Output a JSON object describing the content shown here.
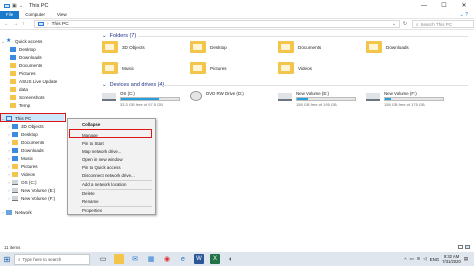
{
  "window": {
    "title": "This PC",
    "min": "—",
    "max": "☐",
    "close": "✕"
  },
  "ribbon": {
    "tabs": [
      "File",
      "Computer",
      "View"
    ],
    "expand": "⌄",
    "help": "?"
  },
  "address": {
    "back": "←",
    "forward": "→",
    "up": "↑",
    "path": "This PC",
    "dropdown": "⌄",
    "refresh": "↻",
    "search_placeholder": "Search This PC"
  },
  "nav": {
    "quick_access": "Quick access",
    "qa_items": [
      "Desktop",
      "Downloads",
      "Documents",
      "Pictures",
      "ASUS Live Update",
      "data",
      "Screenshots",
      "Temp"
    ],
    "this_pc": "This PC",
    "pc_items": [
      "3D Objects",
      "Desktop",
      "Documents",
      "Downloads",
      "Music",
      "Pictures",
      "Videos",
      "OS (C:)",
      "New Volume (E:)",
      "New Volume (F:)"
    ],
    "network": "Network"
  },
  "content": {
    "folders_header": "Folders (7)",
    "folders": [
      "3D Objects",
      "Desktop",
      "Documents",
      "Downloads",
      "Music",
      "Pictures",
      "Videos"
    ],
    "devices_header": "Devices and drives (4)",
    "drives": [
      {
        "name": "OS (C:)",
        "free": "33.3 GB free of 97.5 GB",
        "used_fraction": 0.66
      },
      {
        "name": "DVD RW Drive (D:)",
        "free": "",
        "used_fraction": null
      },
      {
        "name": "New Volume (E:)",
        "free": "158 GB free of 195 GB",
        "used_fraction": 0.19
      },
      {
        "name": "New Volume (F:)",
        "free": "158 GB free of 175 GB",
        "used_fraction": 0.1
      }
    ]
  },
  "context_menu": {
    "items": [
      "Collapse",
      "Manage",
      "Pin to Start",
      "Map network drive...",
      "Open in new window",
      "Pin to Quick access",
      "Disconnect network drive...",
      "Add a network location",
      "Delete",
      "Rename",
      "Properties"
    ]
  },
  "status": {
    "item_count": "11 items"
  },
  "taskbar": {
    "search_placeholder": "Type here to search",
    "time": "9:32 AM",
    "date": "7/31/2020",
    "lang": "ENG"
  },
  "colors": {
    "accent": "#1979ca",
    "highlight_box": "#e11414",
    "drive_fill": "#26a0da",
    "folder": "#f3c54a"
  }
}
